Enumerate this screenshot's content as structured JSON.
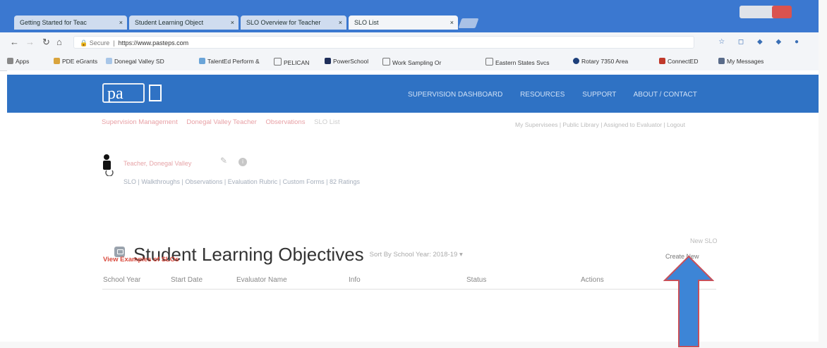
{
  "browser": {
    "tabs": [
      {
        "label": "Getting Started for Teac"
      },
      {
        "label": "Student Learning Object"
      },
      {
        "label": "SLO Overview for Teacher"
      },
      {
        "label": "SLO List"
      }
    ],
    "close_glyph": "×",
    "url_secure": "Secure",
    "url": "https://www.pasteps.com",
    "bookmarks": [
      "Apps",
      "PDE eGrants",
      "Donegal Valley SD",
      "TalentEd Perform &",
      "PELICAN",
      "PowerSchool",
      "Work Sampling Or",
      "Eastern States Svcs",
      "Rotary 7350 Area",
      "ConnectED",
      "My Messages"
    ]
  },
  "site": {
    "logo_text": "pa",
    "nav": [
      "SUPERVISION DASHBOARD",
      "RESOURCES",
      "SUPPORT",
      "ABOUT / CONTACT"
    ],
    "breadcrumbs": [
      "Supervision Management",
      "Donegal Valley Teacher",
      "Observations",
      "SLO List"
    ],
    "right_links": "My Supervisees  |  Public Library  |  Assigned to Evaluator  |  Logout",
    "teacher_link": "Teacher, Donegal Valley",
    "subnav": "SLO  |  Walkthroughs  |  Observations  |  Evaluation Rubric  |  Custom Forms  |  82 Ratings"
  },
  "main": {
    "page_title": "Student Learning Objectives",
    "sort_label": "Sort By School Year:",
    "sort_value": "2018-19",
    "new_slo_label": "New SLO",
    "create_new_label": "Create New",
    "examples_link": "View Examples of SLOs",
    "columns": [
      "School Year",
      "Start Date",
      "Evaluator Name",
      "Info",
      "Status",
      "Actions"
    ]
  },
  "colors": {
    "nav_blue": "#2f72c4",
    "accent_red": "#d94a3d",
    "arrow_blue": "#3d85d6"
  },
  "icons": [
    "back-icon",
    "forward-icon",
    "reload-icon",
    "home-icon",
    "star-icon",
    "person-icon",
    "arrow-up-icon"
  ]
}
